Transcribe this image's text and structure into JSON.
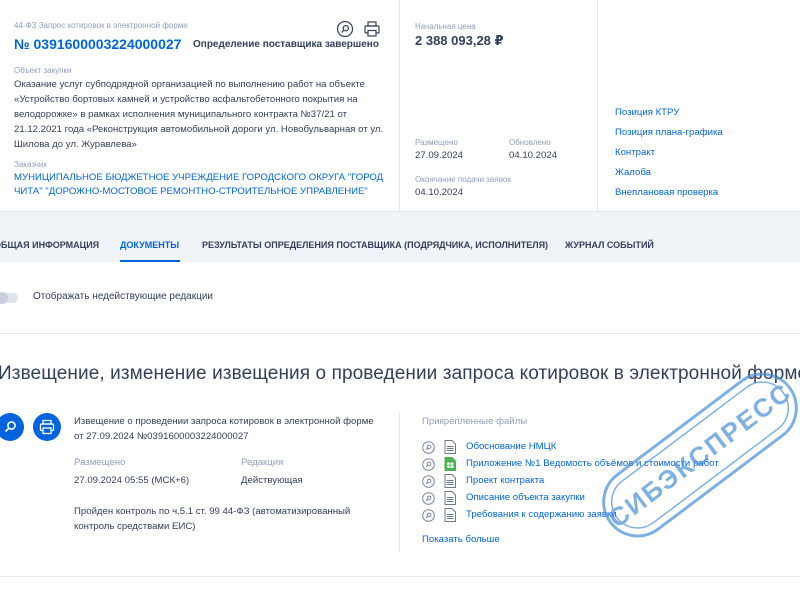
{
  "header": {
    "law_line": "44-ФЗ Запрос котировок в электронной форме",
    "reg_number": "№ 0391600003224000027",
    "status": "Определение поставщика завершено",
    "object_label": "Объект закупки",
    "object_text": "Оказание услуг субподрядной организацией по выполнению работ на объекте «Устройство бортовых камней и устройство асфальтобетонного покрытия на велодорожке» в рамках исполнения муниципального контракта №37/21 от 21.12.2021 года «Реконструкция автомобильной дороги ул. Новобульварная от ул. Шилова до ул. Журавлева»",
    "customer_label": "Заказчик",
    "customer_text": "МУНИЦИПАЛЬНОЕ БЮДЖЕТНОЕ УЧРЕЖДЕНИЕ ГОРОДСКОГО ОКРУГА \"ГОРОД ЧИТА\" \"ДОРОЖНО-МОСТОВОЕ РЕМОНТНО-СТРОИТЕЛЬНОЕ УПРАВЛЕНИЕ\"",
    "price_label": "Начальная цена",
    "price": "2 388 093,28 ₽",
    "placed_label": "Размещено",
    "placed": "27.09.2024",
    "updated_label": "Обновлено",
    "updated": "04.10.2024",
    "deadline_label": "Окончание подачи заявок",
    "deadline": "04.10.2024",
    "links": [
      "Позиция КТРУ",
      "Позиция плана-графика",
      "Контракт",
      "Жалоба",
      "Внеплановая проверка"
    ]
  },
  "tabs": [
    {
      "label": "ОБЩАЯ ИНФОРМАЦИЯ"
    },
    {
      "label": "ДОКУМЕНТЫ"
    },
    {
      "label": "РЕЗУЛЬТАТЫ ОПРЕДЕЛЕНИЯ ПОСТАВЩИКА (ПОДРЯДЧИКА, ИСПОЛНИТЕЛЯ)"
    },
    {
      "label": "ЖУРНАЛ СОБЫТИЙ"
    }
  ],
  "content": {
    "toggle_label": "Отображать недействующие редакции",
    "section_title": "Извещение, изменение извещения о проведении запроса котировок в электронной форме",
    "doc_title": "Извещение о проведении запроса котировок в электронной форме от 27.09.2024 №0391600003224000027",
    "doc_placed_label": "Размещено",
    "doc_placed": "27.09.2024 05:55 (МСК+6)",
    "doc_edition_label": "Редакция",
    "doc_edition": "Действующая",
    "doc_control": "Пройден контроль по ч.5.1 ст. 99 44-ФЗ (автоматизированный контроль средствами ЕИС)",
    "files_label": "Прикрепленные файлы",
    "files": [
      {
        "name": "Обоснование НМЦК",
        "type": "doc"
      },
      {
        "name": "Приложение №1 Ведомость объёмов и стоимости работ",
        "type": "xls"
      },
      {
        "name": "Проект контракта",
        "type": "doc"
      },
      {
        "name": "Описание объекта закупки",
        "type": "doc"
      },
      {
        "name": "Требования к содержанию заявки",
        "type": "doc"
      }
    ],
    "show_more": "Показать больше"
  },
  "watermark": "СИБЭКСПРЕСС",
  "colors": {
    "link": "#0065dd",
    "text": "#334059",
    "muted": "#909ebb",
    "xls": "#4caf50"
  }
}
